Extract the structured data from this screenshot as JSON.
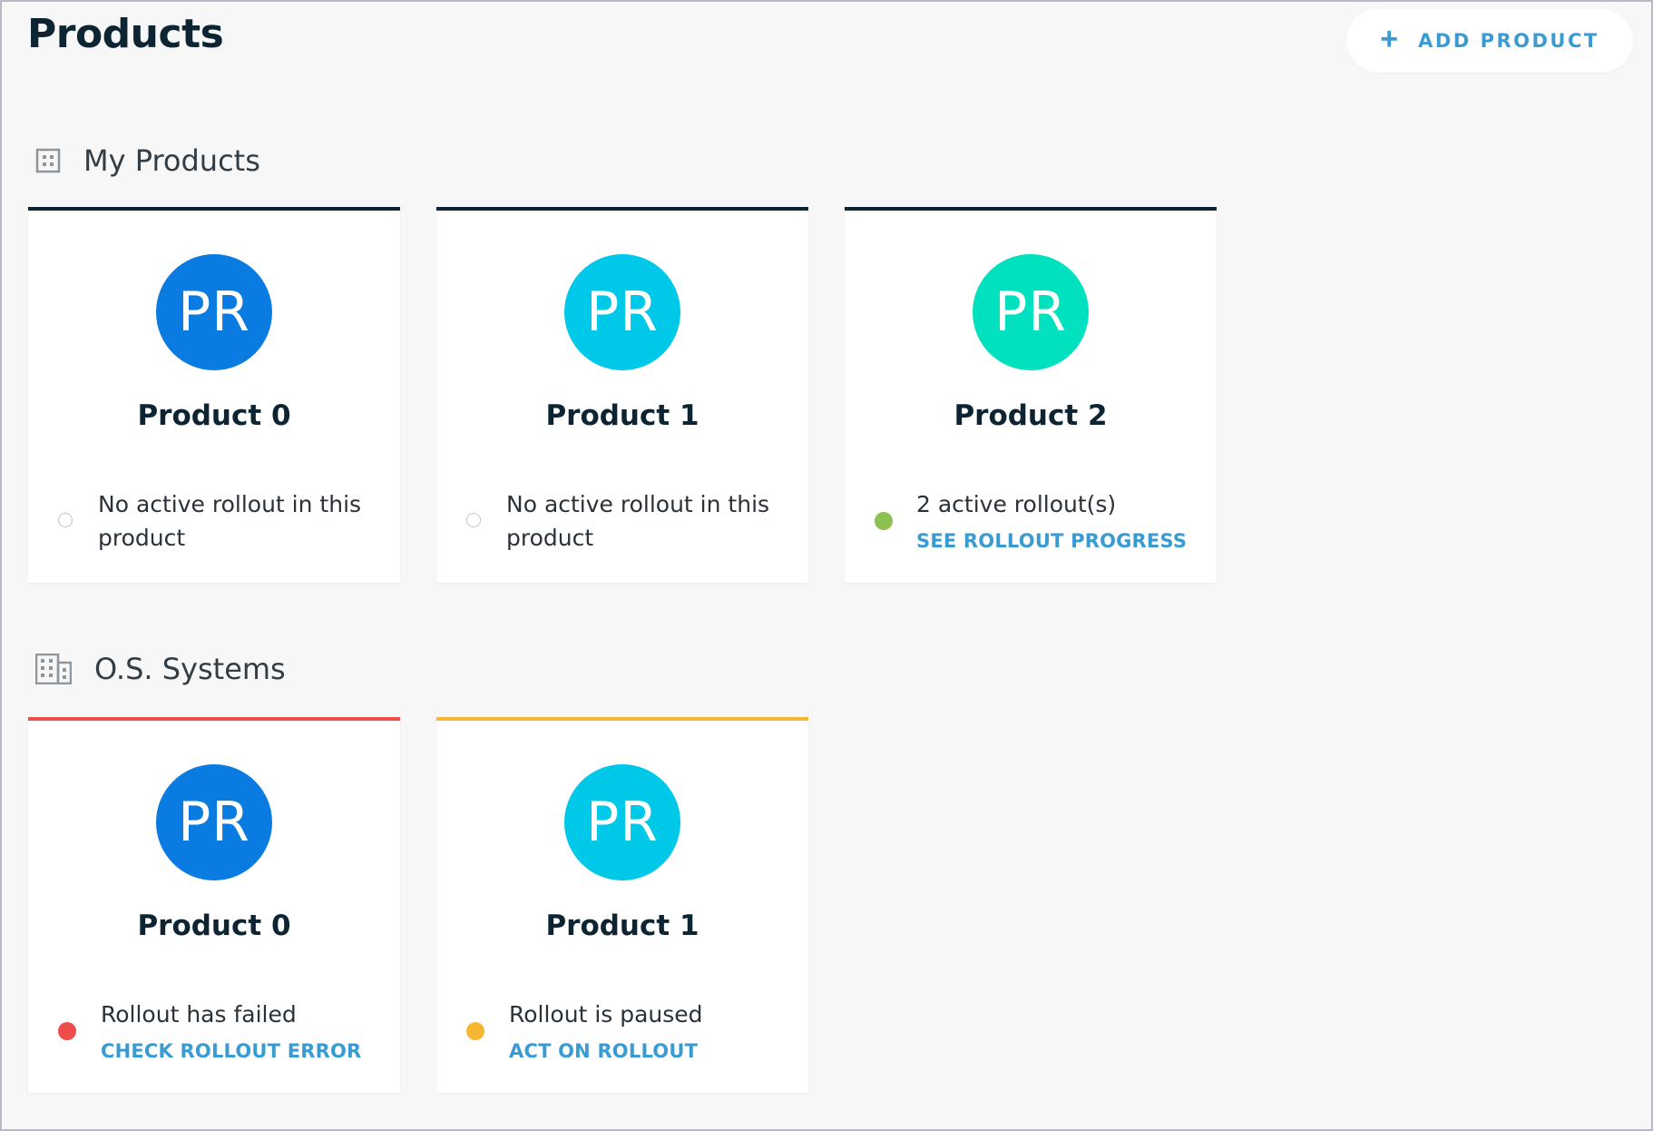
{
  "header": {
    "title": "Products",
    "add_button": {
      "icon": "plus-icon",
      "label": "ADD PRODUCT"
    }
  },
  "sections": [
    {
      "title": "My Products",
      "icon": "building-small-icon",
      "cards": [
        {
          "initials": "PR",
          "name": "Product 0",
          "avatar_color": "#0a7be0",
          "status": "none",
          "status_text": "No active rollout in this product",
          "link": ""
        },
        {
          "initials": "PR",
          "name": "Product 1",
          "avatar_color": "#00c8e8",
          "status": "none",
          "status_text": "No active rollout in this product",
          "link": ""
        },
        {
          "initials": "PR",
          "name": "Product 2",
          "avatar_color": "#00e1bf",
          "status": "active",
          "status_color": "#8cc152",
          "status_text": "2 active rollout(s)",
          "link": "SEE ROLLOUT PROGRESS"
        }
      ]
    },
    {
      "title": "O.S. Systems",
      "icon": "building-large-icon",
      "cards": [
        {
          "initials": "PR",
          "name": "Product 0",
          "avatar_color": "#0a7be0",
          "status": "failed",
          "status_color": "#f04c4c",
          "status_text": "Rollout has failed",
          "link": "CHECK ROLLOUT ERROR"
        },
        {
          "initials": "PR",
          "name": "Product 1",
          "avatar_color": "#00c8e8",
          "status": "paused",
          "status_color": "#f7b733",
          "status_text": "Rollout is paused",
          "link": "ACT ON ROLLOUT"
        }
      ]
    }
  ]
}
